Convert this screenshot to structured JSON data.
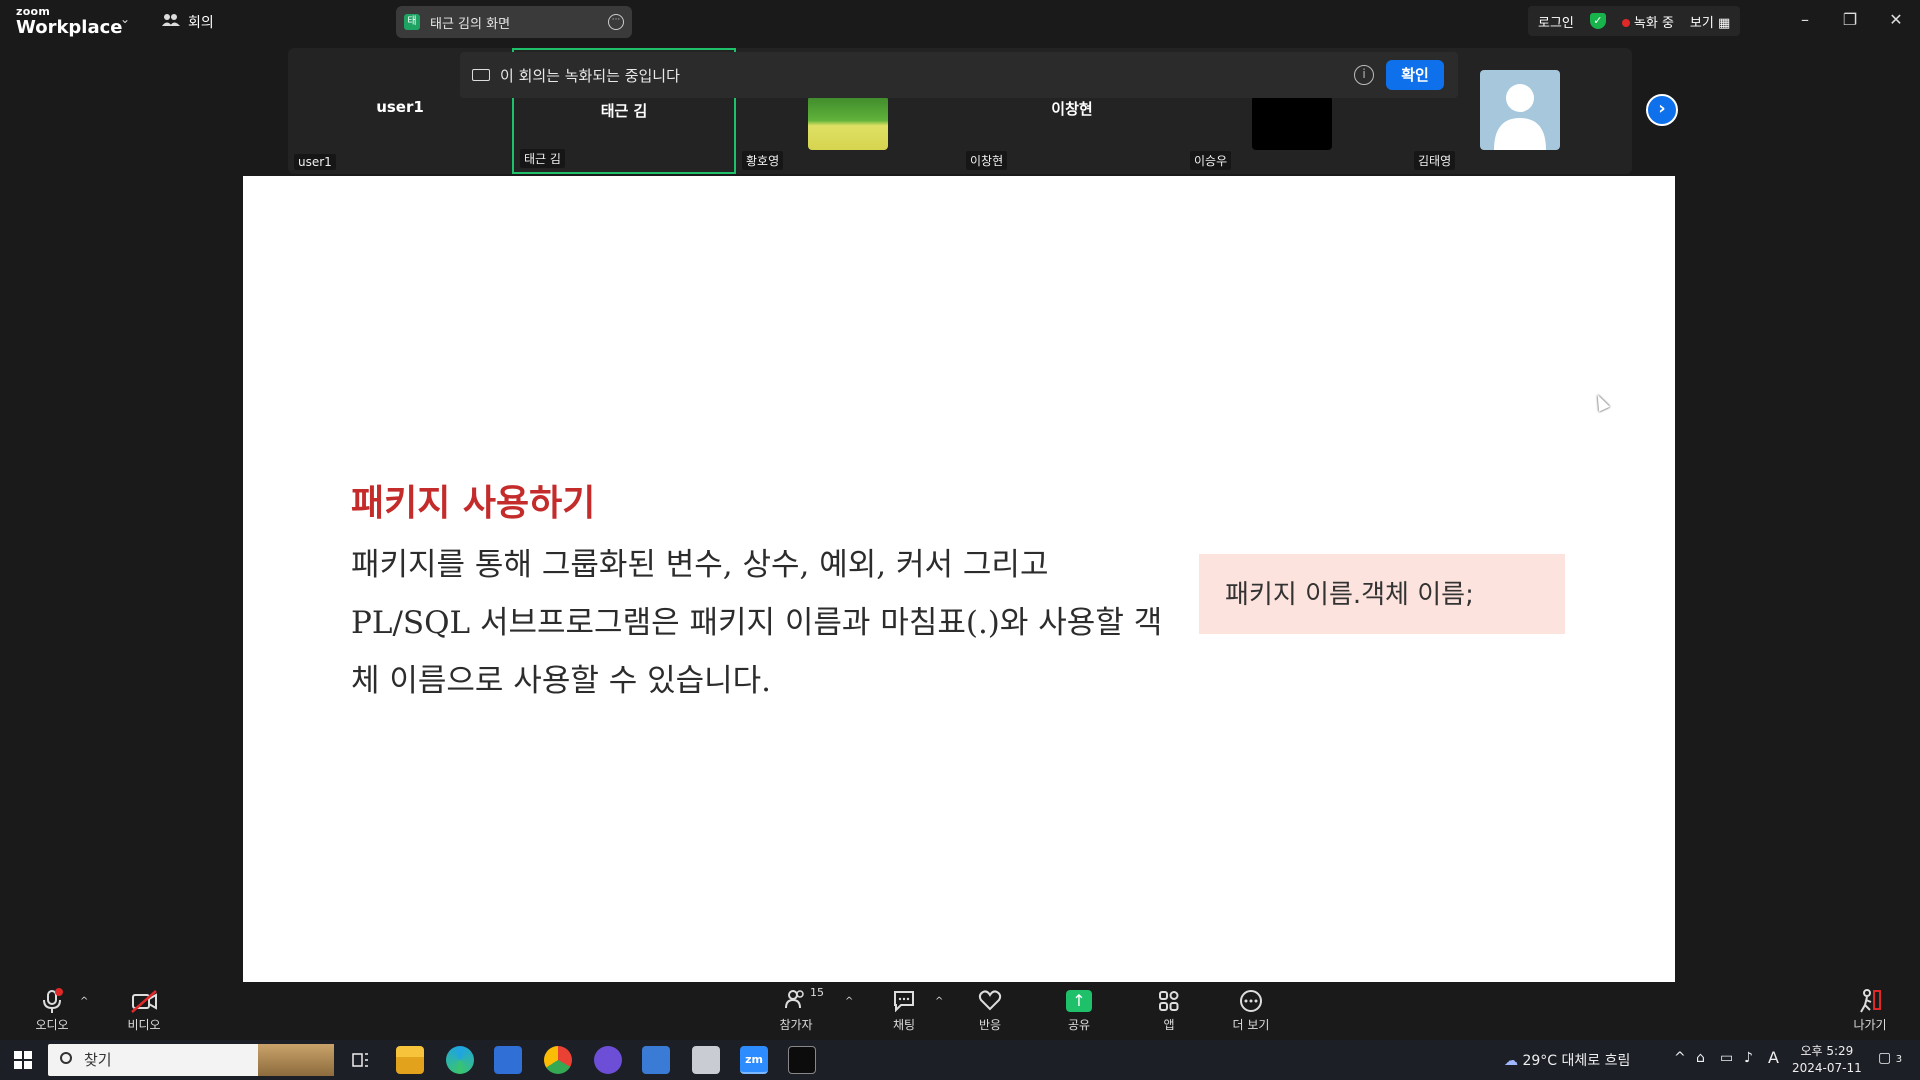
{
  "titlebar": {
    "logo_small": "zoom",
    "logo_big": "Workplace",
    "meeting_label": "회의",
    "share_tab_badge": "태",
    "share_tab_title": "태근 김의 화면",
    "login": "로그인",
    "recording": "녹화 중",
    "view": "보기"
  },
  "participants": [
    {
      "center": "user1",
      "label": "user1"
    },
    {
      "center": "태근 김",
      "label": "태근 김"
    },
    {
      "center": "",
      "label": "황호영"
    },
    {
      "center": "이창현",
      "label": "이창현"
    },
    {
      "center": "",
      "label": "이승우"
    },
    {
      "center": "",
      "label": "김태영"
    }
  ],
  "banner": {
    "text": "이 회의는 녹화되는 중입니다",
    "info": "i",
    "ok": "확인"
  },
  "slide": {
    "title": "패키지 사용하기",
    "body": "패키지를 통해 그룹화된 변수, 상수, 예외, 커서 그리고 PL/SQL 서브프로그램은 패키지 이름과 마침표(.)와 사용할 객체 이름으로 사용할 수 있습니다.",
    "box": "패키지 이름.객체 이름;"
  },
  "toolbar": {
    "audio": "오디오",
    "video": "비디오",
    "participants": "참가자",
    "participants_count": "15",
    "chat": "채팅",
    "reactions": "반응",
    "share": "공유",
    "apps": "앱",
    "more": "더 보기",
    "leave": "나가기"
  },
  "taskbar": {
    "search": "찾기",
    "weather": "29°C 대체로 흐림",
    "time": "오후 5:29",
    "date": "2024-07-11",
    "ime": "A",
    "notifications": "3"
  }
}
